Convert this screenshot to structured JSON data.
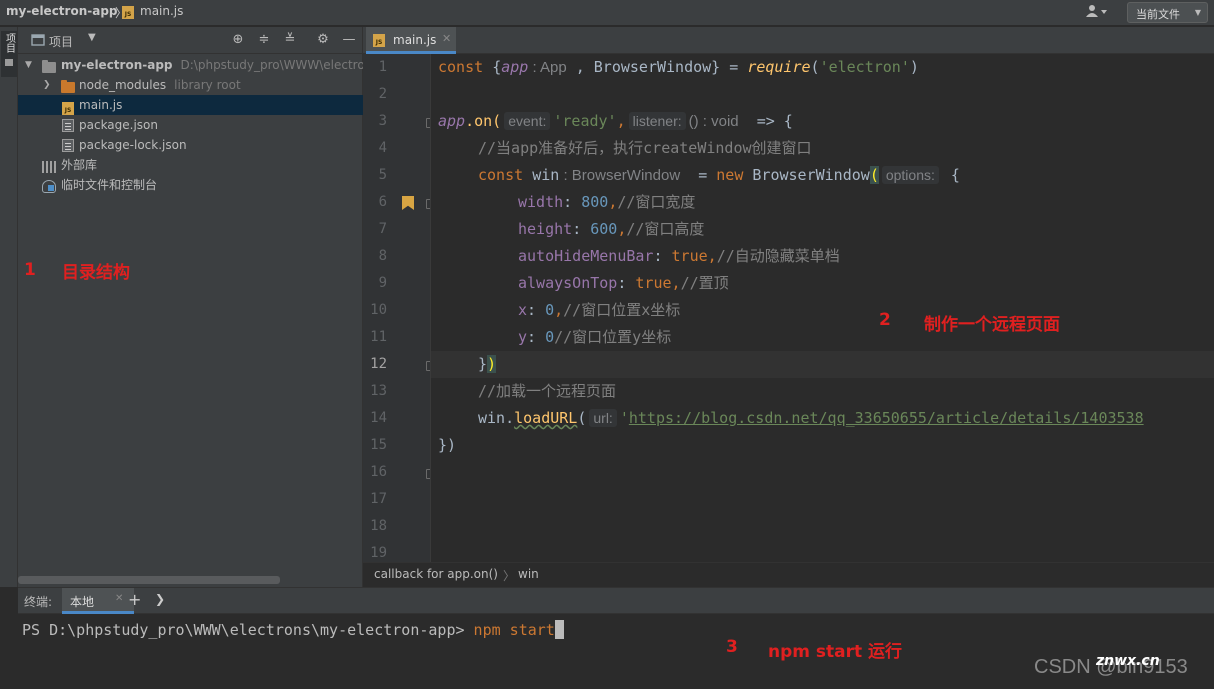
{
  "navbar": {
    "project": "my-electron-app",
    "separator": "〉",
    "file": "main.js",
    "config": "当前文件"
  },
  "tool_stripe": {
    "project": "项目"
  },
  "project_panel": {
    "title": "项目",
    "tree": [
      {
        "label": "my-electron-app",
        "hint": "D:\\phpstudy_pro\\WWW\\electrons",
        "icon": "folder-icon"
      },
      {
        "label": "node_modules",
        "hint": "library root",
        "icon": "folder-icon"
      },
      {
        "label": "main.js",
        "icon": "js-file-icon"
      },
      {
        "label": "package.json",
        "icon": "json-file-icon"
      },
      {
        "label": "package-lock.json",
        "icon": "json-file-icon"
      },
      {
        "label": "外部库",
        "icon": "library-icon"
      },
      {
        "label": "临时文件和控制台",
        "icon": "scratch-icon"
      }
    ]
  },
  "editor": {
    "tab": "main.js",
    "lines": [
      "1",
      "2",
      "3",
      "4",
      "5",
      "6",
      "7",
      "8",
      "9",
      "10",
      "11",
      "12",
      "13",
      "14",
      "15",
      "16",
      "17",
      "18",
      "19"
    ],
    "current_line": "12",
    "breadcrumb": [
      "callback for app.on()",
      "win"
    ],
    "code": {
      "l1": {
        "const": "const ",
        "brace_open": "{",
        "app": "app",
        "app_hint": " : App",
        "comma": " , BrowserWindow} = ",
        "require": "require",
        "paren": "(",
        "str": "'electron'",
        "close": ")"
      },
      "l3": {
        "app": "app",
        "dot_on": ".on(",
        "event_hint": "event:",
        "ready": "'ready'",
        "comma": ",",
        "listener_hint": "listener:",
        "sig": "() : void",
        "arrow": "  => {"
      },
      "l4": {
        "comment": "//当app准备好后，执行createWindow创建窗口"
      },
      "l5": {
        "const": "const ",
        "win": "win",
        "win_hint": " : BrowserWindow",
        "eq": "  = ",
        "new": "new ",
        "cls": "BrowserWindow",
        "paren": "(",
        "opt_hint": "options:",
        "brace": " {"
      },
      "l6": {
        "prop": "width",
        "colon": ": ",
        "num": "800",
        "rest": ",",
        "comment": "//窗口宽度"
      },
      "l7": {
        "prop": "height",
        "colon": ": ",
        "num": "600",
        "rest": ",",
        "comment": "//窗口高度"
      },
      "l8": {
        "prop": "autoHideMenuBar",
        "colon": ": ",
        "kw": "true",
        "rest": ",",
        "comment": "//自动隐藏菜单档"
      },
      "l9": {
        "prop": "alwaysOnTop",
        "colon": ": ",
        "kw": "true",
        "rest": ",",
        "comment": "//置顶"
      },
      "l10": {
        "prop": "x",
        "colon": ": ",
        "num": "0",
        "rest": ",",
        "comment": "//窗口位置x坐标"
      },
      "l11": {
        "prop": "y",
        "colon": ": ",
        "num": "0",
        "comment": "//窗口位置y坐标"
      },
      "l12": {
        "brace": "}",
        "paren": ")"
      },
      "l13": {
        "comment": "//加载一个远程页面"
      },
      "l14": {
        "win": "win.",
        "fn": "loadURL",
        "paren": "(",
        "url_hint": "url:",
        "q": "'",
        "url": "https://blog.csdn.net/qq_33650655/article/details/1403538"
      },
      "l15": {
        "close": "})"
      }
    }
  },
  "annotations": {
    "a1_num": "1",
    "a1_text": "目录结构",
    "a2_num": "2",
    "a2_text": "制作一个远程页面",
    "a3_num": "3",
    "a3_text": "npm start 运行"
  },
  "terminal": {
    "label": "终端:",
    "tab": "本地",
    "prompt": "PS D:\\phpstudy_pro\\WWW\\electrons\\my-electron-app> ",
    "command": "npm start"
  },
  "watermark": {
    "text": "CSDN @bin9153",
    "overlay": "znwx.cn"
  },
  "colors": {
    "keyword": "#cc7832",
    "string": "#6a8759",
    "number": "#6897bb",
    "property": "#9876aa",
    "function": "#ffc66d",
    "comment": "#808080",
    "selection": "#0d293e",
    "annotation": "#e02020"
  }
}
